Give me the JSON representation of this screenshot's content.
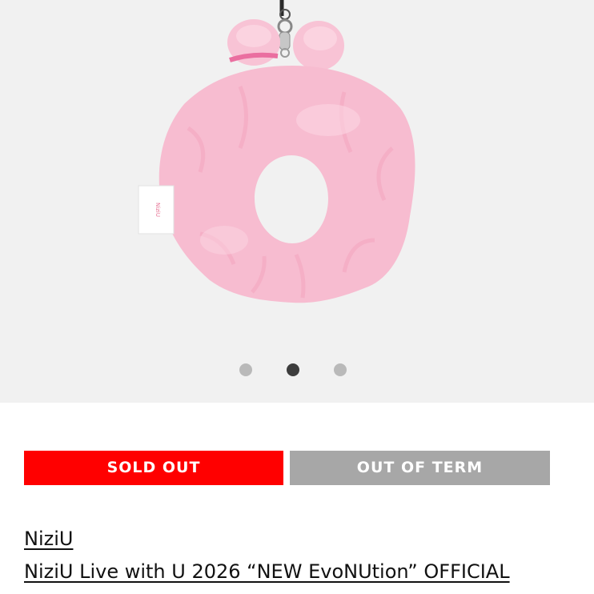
{
  "gallery": {
    "image_subject": "pink plush scrunchie charm with bunny ears and keychain clasp",
    "tag_text": "NiziU",
    "dots": [
      {
        "label": "slide 1",
        "active": false
      },
      {
        "label": "slide 2",
        "active": true
      },
      {
        "label": "slide 3",
        "active": false
      }
    ],
    "colors": {
      "background": "#f1f1f1",
      "pink": "#f7bfd2",
      "dot_active": "#3d3d3d",
      "dot_inactive": "#b9b9b9"
    }
  },
  "status": {
    "sold_out_label": "SOLD OUT",
    "term_label": "OUT OF TERM",
    "colors": {
      "sold_out": "#ff0000",
      "term": "#a7a7a7"
    }
  },
  "product": {
    "artist": "NiziU",
    "title": "NiziU Live with U 2026 “NEW EvoNUtion” OFFICIAL"
  }
}
